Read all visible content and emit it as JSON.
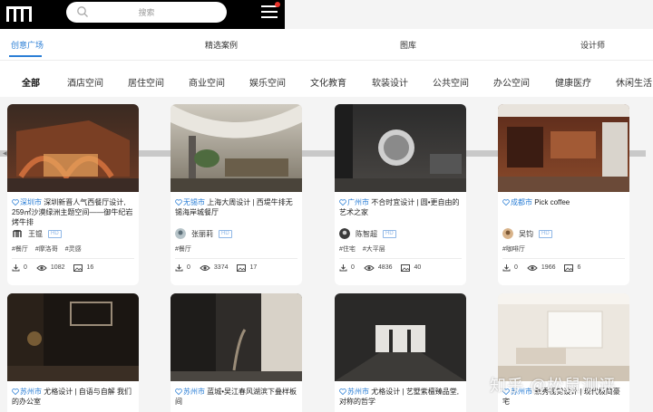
{
  "header": {
    "logo_icon": "site-logo-icon",
    "search": {
      "placeholder": "搜索",
      "icon": "search-icon"
    },
    "menu_icon": "hamburger-menu-icon",
    "notification_dot_color": "#e8332a"
  },
  "tabs": [
    {
      "label": "创意广场",
      "active": true
    },
    {
      "label": "精选案例",
      "active": false
    },
    {
      "label": "图库",
      "active": false
    },
    {
      "label": "设计师",
      "active": false
    }
  ],
  "categories": [
    {
      "label": "全部",
      "active": true
    },
    {
      "label": "酒店空间",
      "active": false
    },
    {
      "label": "居住空间",
      "active": false
    },
    {
      "label": "商业空间",
      "active": false
    },
    {
      "label": "娱乐空间",
      "active": false
    },
    {
      "label": "文化教育",
      "active": false
    },
    {
      "label": "软装设计",
      "active": false
    },
    {
      "label": "公共空间",
      "active": false
    },
    {
      "label": "办公空间",
      "active": false
    },
    {
      "label": "健康医疗",
      "active": false
    },
    {
      "label": "休闲生活",
      "active": false
    }
  ],
  "cards": [
    {
      "city": "深圳市",
      "title": "深圳新晋人气西餐厅设计, 259㎡沙漠绿洲主题空间——御牛纪岩烤牛排",
      "author": "王锟",
      "badge": "HD",
      "tags": [
        "#餐厅",
        "#摩洛哥",
        "#灵感"
      ],
      "downloads": "0",
      "views": "1082",
      "images": "16"
    },
    {
      "city": "无锡市",
      "title": "上海大周设计 | 西堤牛排无锡海岸城餐厅",
      "author": "张丽莉",
      "badge": "HD",
      "tags": [
        "#餐厅"
      ],
      "downloads": "0",
      "views": "3374",
      "images": "17"
    },
    {
      "city": "广州市",
      "title": "不合时宜设计 | 圆•更自由的艺术之家",
      "author": "陈智超",
      "badge": "HD",
      "tags": [
        "#住宅",
        "#大平层"
      ],
      "downloads": "0",
      "views": "4836",
      "images": "40"
    },
    {
      "city": "成都市",
      "title": "Pick coffee",
      "author": "吴钧",
      "badge": "HD",
      "tags": [
        "#咖啡厅"
      ],
      "downloads": "0",
      "views": "1966",
      "images": "6"
    },
    {
      "city": "苏州市",
      "title": "尤格设计 | 自语与自解 我们的办公室"
    },
    {
      "city": "苏州市",
      "title": "蓝城•吴江春风湖滨下叠样板间"
    },
    {
      "city": "苏州市",
      "title": "尤格设计 | 艺墅紫檀臻品堂, 对称的哲学"
    },
    {
      "city": "苏州市",
      "title": "默秀视觉设计 | 现代极简豪宅"
    }
  ],
  "watermark": "知乎 @松鼠测评",
  "colors": {
    "accent": "#2c7fd6",
    "header_bg": "#000000"
  }
}
